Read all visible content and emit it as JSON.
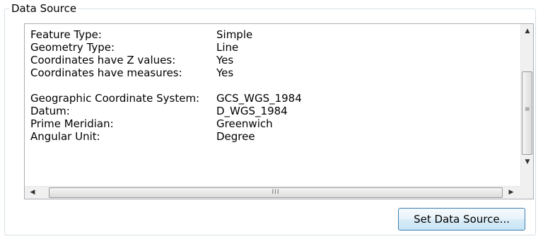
{
  "group": {
    "title": "Data Source"
  },
  "properties": [
    {
      "label": "Feature Type:",
      "value": "Simple"
    },
    {
      "label": "Geometry Type:",
      "value": "Line"
    },
    {
      "label": "Coordinates have Z values:",
      "value": "Yes"
    },
    {
      "label": "Coordinates have measures:",
      "value": "Yes"
    },
    {
      "label": "",
      "value": ""
    },
    {
      "label": "Geographic Coordinate System:",
      "value": "GCS_WGS_1984"
    },
    {
      "label": "Datum:",
      "value": "D_WGS_1984"
    },
    {
      "label": "Prime Meridian:",
      "value": "Greenwich"
    },
    {
      "label": "Angular Unit:",
      "value": "Degree"
    }
  ],
  "scrollbars": {
    "up_glyph": "▲",
    "down_glyph": "▼",
    "left_glyph": "◀",
    "right_glyph": "▶",
    "vgrip": "≡",
    "hgrip": "III"
  },
  "buttons": {
    "set_data_source": "Set Data Source..."
  }
}
